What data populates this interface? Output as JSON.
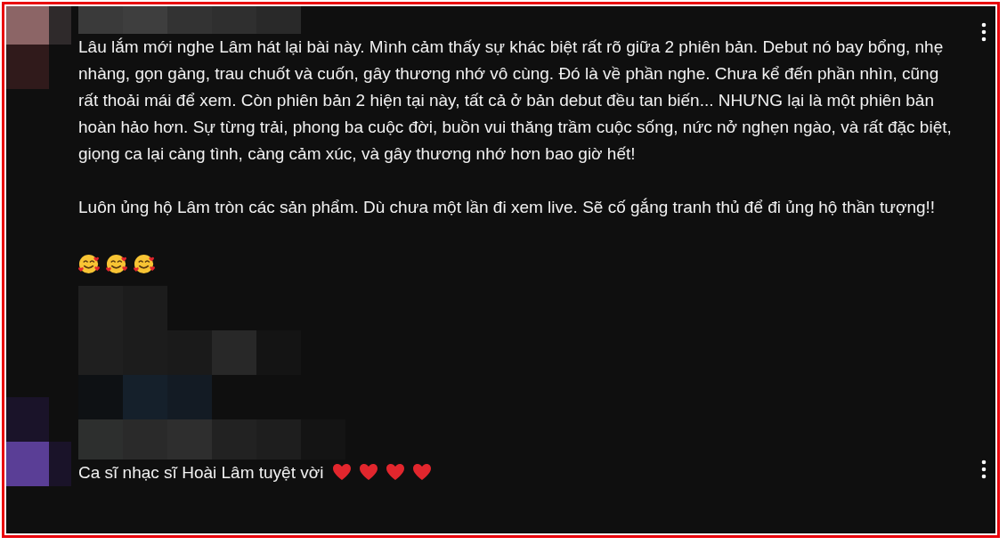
{
  "comments": [
    {
      "avatar": {
        "kind": "picture"
      },
      "author": {
        "kind": "picture"
      },
      "paragraphs": [
        "Lâu lắm mới nghe Lâm hát lại bài này. Mình cảm thấy sự khác biệt rất rõ giữa 2 phiên bản. Debut nó bay bổng, nhẹ nhàng, gọn gàng, trau chuốt và cuốn,  gây thương nhớ vô cùng. Đó là về phần nghe. Chưa kể đến phần nhìn, cũng rất thoải mái để xem. Còn phiên bản 2 hiện tại này,  tất cả ở bản debut đều tan biến... NHƯNG lại là một phiên bản hoàn hảo hơn. Sự từng trải, phong ba cuộc đời, buồn vui thăng trầm cuộc sống, nức nở nghẹn ngào, và rất đặc biệt,  giọng ca lại càng tình, càng cảm xúc, và gây thương nhớ hơn bao giờ hết!",
        "Luôn ủng hộ Lâm tròn các sản phẩm. Dù chưa một lần đi xem live. Sẽ cố gắng tranh thủ để đi ủng hộ thần tượng!!"
      ],
      "emojis": [
        {
          "kind": "smiling-face-with-hearts"
        },
        {
          "kind": "smiling-face-with-hearts"
        },
        {
          "kind": "smiling-face-with-hearts"
        }
      ],
      "replies": {
        "kind": "picture"
      }
    },
    {
      "avatar": {
        "kind": "picture"
      },
      "author": {
        "kind": "picture"
      },
      "paragraphs": [
        "Ca sĩ nhạc sĩ Hoài Lâm tuyệt vời"
      ],
      "emojis": [
        {
          "kind": "red-heart"
        },
        {
          "kind": "red-heart"
        },
        {
          "kind": "red-heart"
        },
        {
          "kind": "red-heart"
        }
      ]
    }
  ]
}
